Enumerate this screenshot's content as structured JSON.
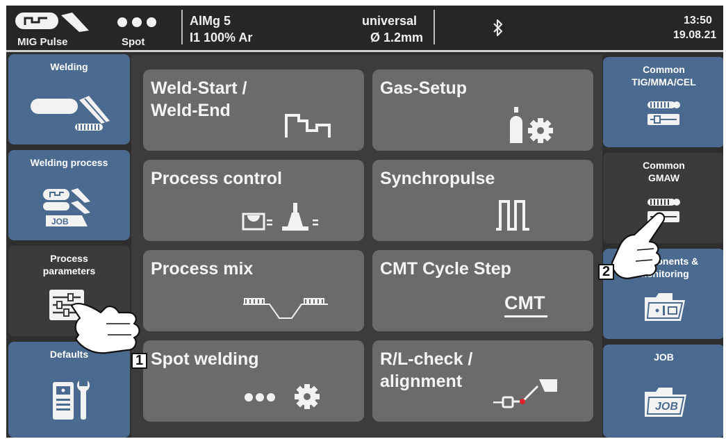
{
  "status_bar": {
    "mode_label": "MIG Pulse",
    "spot_label": "Spot",
    "material": "AlMg 5",
    "gas": "I1 100% Ar",
    "wire_type": "universal",
    "wire_diameter": "Ø 1.2mm",
    "time": "13:50",
    "date": "19.08.21"
  },
  "left_menu": [
    {
      "label": "Welding",
      "icon": "welding-torch-icon"
    },
    {
      "label": "Welding process",
      "icon": "welding-process-job-icon"
    },
    {
      "label": "Process\nparameters",
      "icon": "process-parameters-sliders-icon",
      "selected": true
    },
    {
      "label": "Defaults",
      "icon": "machine-wrench-icon"
    }
  ],
  "main_tiles": [
    {
      "label": "Weld-Start /\nWeld-End",
      "icon": "weld-start-end-profile-icon"
    },
    {
      "label": "Gas-Setup",
      "icon": "gas-bottle-gear-icon"
    },
    {
      "label": "Process control",
      "icon": "process-control-icon"
    },
    {
      "label": "Synchropulse",
      "icon": "synchropulse-waveform-icon"
    },
    {
      "label": "Process mix",
      "icon": "process-mix-icon"
    },
    {
      "label": "CMT Cycle Step",
      "icon": "cmt-text-icon",
      "icon_text": "CMT"
    },
    {
      "label": "Spot welding",
      "icon": "spot-dots-gear-icon"
    },
    {
      "label": "R/L-check /\nalignment",
      "icon": "rl-check-probe-icon"
    }
  ],
  "right_menu": [
    {
      "label": "Common\nTIG/MMA/CEL",
      "icon": "common-settings-icon"
    },
    {
      "label": "Common\nGMAW",
      "icon": "common-settings-icon",
      "selected": true
    },
    {
      "label": "Components &\nMonitoring",
      "icon": "components-folder-icon"
    },
    {
      "label": "JOB",
      "icon": "job-folder-icon",
      "icon_text": "JOB"
    }
  ],
  "callouts": [
    "1",
    "2"
  ],
  "colors": {
    "status_bar": "#262626",
    "screen_bg": "#2e2e2e",
    "side_blue": "#4b6a8f",
    "side_selected": "#3b3b3b",
    "main_panel": "#3c3c3c",
    "tile": "#6b6b6b",
    "rl_check_dot": "#e0202a"
  }
}
